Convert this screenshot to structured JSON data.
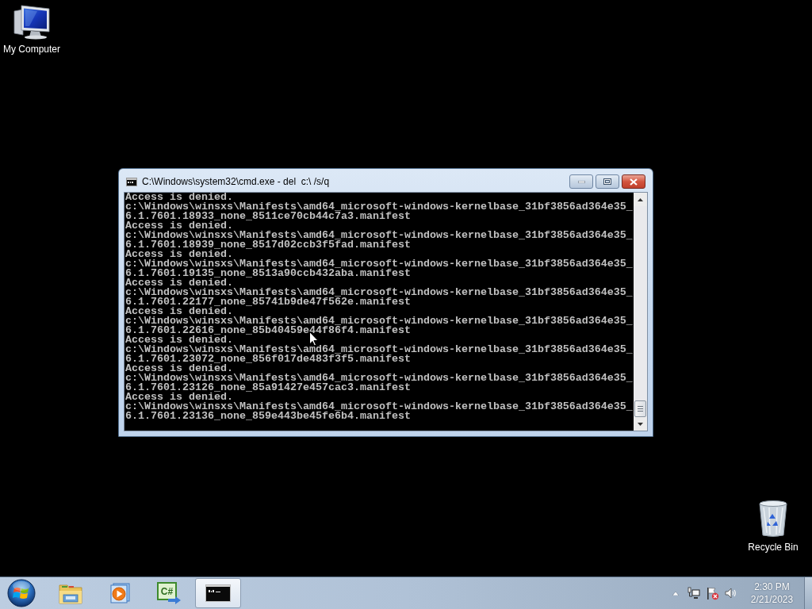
{
  "desktop_icons": [
    {
      "kind": "computer",
      "label": "My Computer"
    },
    {
      "kind": "recycle_bin",
      "label": "Recycle Bin"
    }
  ],
  "console_window": {
    "title": "C:\\Windows\\system32\\cmd.exe - del  c:\\ /s/q",
    "lines": [
      "Access is denied.",
      "c:\\Windows\\winsxs\\Manifests\\amd64_microsoft-windows-kernelbase_31bf3856ad364e35_",
      "6.1.7601.18933_none_8511ce70cb44c7a3.manifest",
      "Access is denied.",
      "c:\\Windows\\winsxs\\Manifests\\amd64_microsoft-windows-kernelbase_31bf3856ad364e35_",
      "6.1.7601.18939_none_8517d02ccb3f5fad.manifest",
      "Access is denied.",
      "c:\\Windows\\winsxs\\Manifests\\amd64_microsoft-windows-kernelbase_31bf3856ad364e35_",
      "6.1.7601.19135_none_8513a90ccb432aba.manifest",
      "Access is denied.",
      "c:\\Windows\\winsxs\\Manifests\\amd64_microsoft-windows-kernelbase_31bf3856ad364e35_",
      "6.1.7601.22177_none_85741b9de47f562e.manifest",
      "Access is denied.",
      "c:\\Windows\\winsxs\\Manifests\\amd64_microsoft-windows-kernelbase_31bf3856ad364e35_",
      "6.1.7601.22616_none_85b40459e44f86f4.manifest",
      "Access is denied.",
      "c:\\Windows\\winsxs\\Manifests\\amd64_microsoft-windows-kernelbase_31bf3856ad364e35_",
      "6.1.7601.23072_none_856f017de483f3f5.manifest",
      "Access is denied.",
      "c:\\Windows\\winsxs\\Manifests\\amd64_microsoft-windows-kernelbase_31bf3856ad364e35_",
      "6.1.7601.23126_none_85a91427e457cac3.manifest",
      "Access is denied.",
      "c:\\Windows\\winsxs\\Manifests\\amd64_microsoft-windows-kernelbase_31bf3856ad364e35_",
      "6.1.7601.23136_none_859e443be45fe6b4.manifest"
    ]
  },
  "taskbar": {
    "buttons": [
      {
        "kind": "explorer",
        "selected": false
      },
      {
        "kind": "media_player",
        "selected": false
      },
      {
        "kind": "csharp",
        "label": "C#",
        "selected": false
      },
      {
        "kind": "console",
        "selected": true
      }
    ],
    "clock": {
      "time": "2:30 PM",
      "date": "2/21/2023"
    }
  }
}
